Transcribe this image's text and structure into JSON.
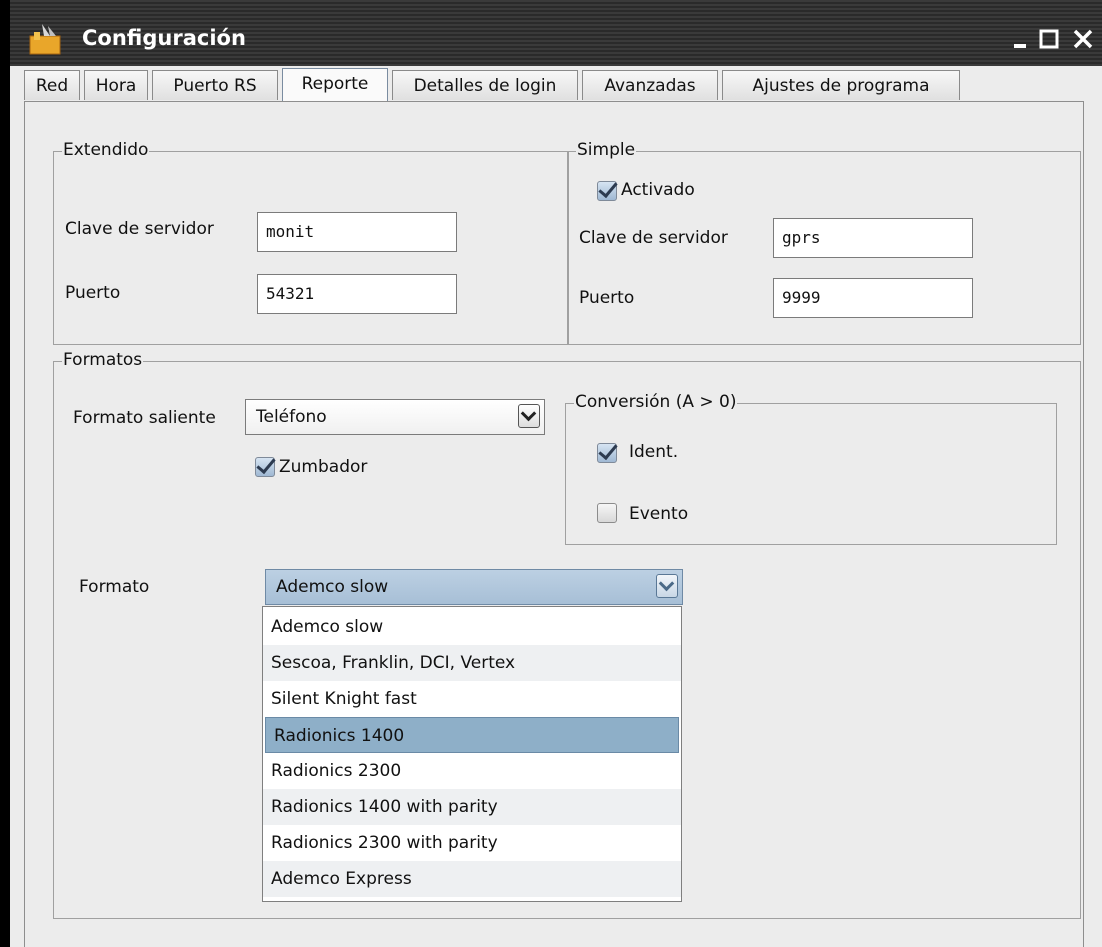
{
  "window": {
    "title": "Configuración"
  },
  "tabs": [
    "Red",
    "Hora",
    "Puerto RS",
    "Reporte",
    "Detalles de login",
    "Avanzadas",
    "Ajustes de programa"
  ],
  "active_tab": "Reporte",
  "extendido": {
    "legend": "Extendido",
    "server_key_label": "Clave de servidor",
    "server_key_value": "monit",
    "port_label": "Puerto",
    "port_value": "54321"
  },
  "simple": {
    "legend": "Simple",
    "enabled_label": "Activado",
    "enabled": true,
    "server_key_label": "Clave de servidor",
    "server_key_value": "gprs",
    "port_label": "Puerto",
    "port_value": "9999"
  },
  "formatos": {
    "legend": "Formatos",
    "outgoing_label": "Formato saliente",
    "outgoing_value": "Teléfono",
    "buzzer_label": "Zumbador",
    "buzzer": true,
    "conversion": {
      "legend": "Conversión (A > 0)",
      "ident_label": "Ident.",
      "ident": true,
      "event_label": "Evento",
      "event": false
    },
    "format_label": "Formato",
    "format_value": "Ademco slow",
    "options": [
      "Ademco slow",
      "Sescoa, Franklin, DCI, Vertex",
      "Silent Knight fast",
      "Radionics 1400",
      "Radionics 2300",
      "Radionics 1400 with parity",
      "Radionics 2300 with parity",
      "Ademco Express"
    ],
    "highlighted_option": "Radionics 1400"
  }
}
